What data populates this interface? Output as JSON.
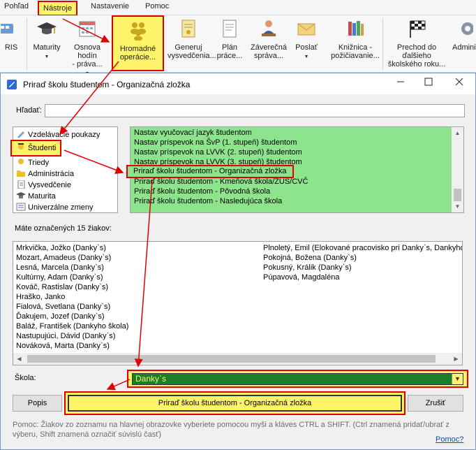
{
  "menubar": {
    "items": [
      "Pohľad",
      "Nástroje",
      "Nastavenie",
      "Pomoc"
    ]
  },
  "ribbon": {
    "buttons": [
      {
        "label": "RIS",
        "icon": "ris-icon"
      },
      {
        "label": "Maturity",
        "icon": "graduation-cap-icon"
      },
      {
        "label": "Osnova hodín\n- práva...",
        "icon": "calendar-icon"
      },
      {
        "label": "Hromadné\noperácie...",
        "icon": "people-group-icon"
      },
      {
        "label": "Generuj\nvysvedčenia...",
        "icon": "certificate-icon"
      },
      {
        "label": "Plán\npráce...",
        "icon": "plan-icon"
      },
      {
        "label": "Záverečná\nspráva...",
        "icon": "teacher-icon"
      },
      {
        "label": "Poslať",
        "icon": "envelope-icon"
      },
      {
        "label": "Knižnica -\npožičiavanie...",
        "icon": "books-icon"
      },
      {
        "label": "Prechod do\nďalšieho\nškolského roku...",
        "icon": "checkered-flag-icon"
      },
      {
        "label": "Admini",
        "icon": "gear-icon"
      }
    ]
  },
  "dialog": {
    "title": "Priraď školu študentom - Organizačná zložka",
    "search_label": "Hľadať:",
    "categories": [
      "Vzdelávacie poukazy",
      "Študenti",
      "Triedy",
      "Administrácia",
      "Vysvedčenie",
      "Maturita",
      "Univerzálne zmeny"
    ],
    "operations": [
      "Nastav vyučovací jazyk študentom",
      "Nastav príspevok na ŠvP (1. stupeň) študentom",
      "Nastav príspevok na LVVK (2. stupeň) študentom",
      "Nastav príspevok na LVVK (3. stupeň) študentom",
      "Priraď školu študentom - Organizačná zložka",
      "Priraď školu študentom - Kmeňová škola/ZUŠ/CVČ",
      "Priraď školu študentom - Pôvodná škola",
      "Priraď školu študentom - Nasledujúca škola"
    ],
    "count_label": "Máte označených 15 žiakov:",
    "students_col1": [
      "Mrkvička, Jožko (Danky`s)",
      "Mozart, Amadeus (Danky`s)",
      "Lesná, Marcela (Danky`s)",
      "Kultúrny, Adam (Danky`s)",
      "Kováč, Rastislav (Danky`s)",
      "Hraško, Janko",
      "Fialová, Svetlana (Danky`s)",
      "Ďakujem, Jozef (Danky`s)",
      "Baláž, František (Dankyho škola)",
      "Nastupujúci, Dávid (Danky`s)",
      "Nováková, Marta (Danky`s)"
    ],
    "students_col2": [
      "Plnoletý, Emil (Elokované pracovisko pri Danky`s, Dankyho",
      "Pokojná, Božena (Danky`s)",
      "Pokusný, Králik (Danky`s)",
      "Púpavová, Magdaléna"
    ],
    "school_label": "Škola:",
    "school_value": "Danky`s",
    "buttons": {
      "popis": "Popis",
      "apply": "Priraď školu študentom - Organizačná zložka",
      "cancel": "Zrušiť"
    },
    "help_text": "Pomoc: Žiakov zo zoznamu na hlavnej obrazovke vyberiete pomocou myši a kláves CTRL a SHIFT. (Ctrl znamená pridať/ubrať z výberu, Shift znamená označiť súvislú časť)",
    "help_link": "Pomoc?"
  },
  "colors": {
    "highlight_fill": "#fff36a",
    "highlight_border": "#e00000",
    "ops_background": "#8de48d",
    "school_select_bg": "#1a7f26"
  }
}
